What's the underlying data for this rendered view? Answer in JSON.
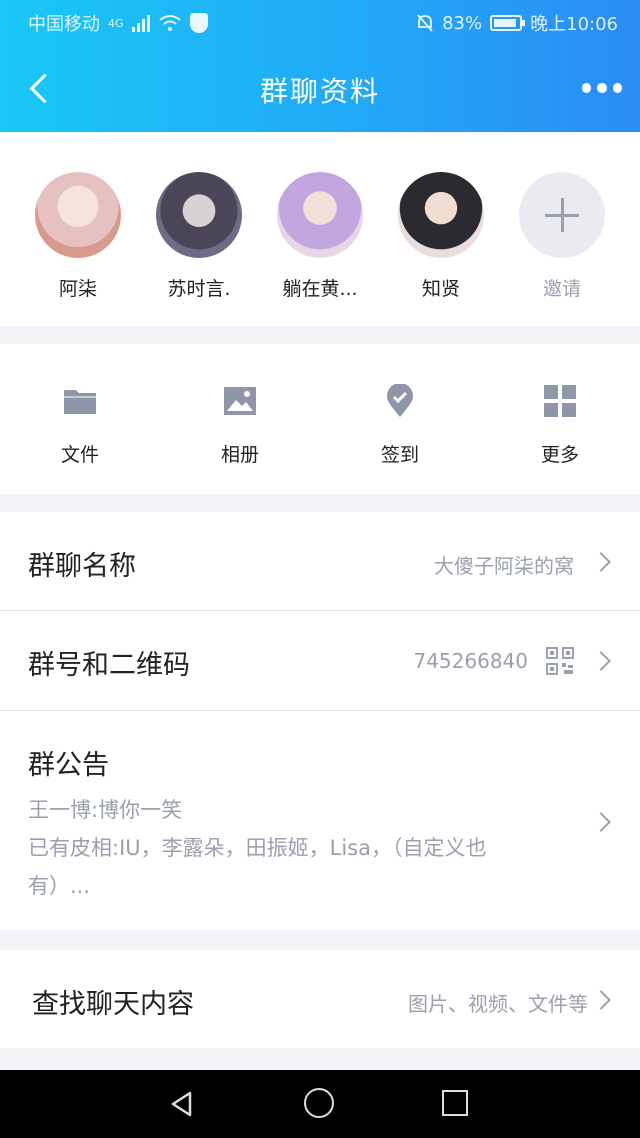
{
  "status_bar": {
    "carrier": "中国移动",
    "network": "4G",
    "battery": "83%",
    "time": "晚上10:06"
  },
  "nav": {
    "title": "群聊资料"
  },
  "members": [
    {
      "name": "阿柒",
      "avatar_color": "#e8c9c8"
    },
    {
      "name": "苏时言.",
      "avatar_color": "#5a5a6e"
    },
    {
      "name": "躺在黄...",
      "avatar_color": "#b79bd9"
    },
    {
      "name": "知贤",
      "avatar_color": "#3c3c46"
    }
  ],
  "invite": {
    "label": "邀请"
  },
  "features": [
    {
      "label": "文件",
      "icon": "folder-icon"
    },
    {
      "label": "相册",
      "icon": "image-icon"
    },
    {
      "label": "签到",
      "icon": "checkin-icon"
    },
    {
      "label": "更多",
      "icon": "grid-icon"
    }
  ],
  "group_name": {
    "label": "群聊名称",
    "value": "大傻子阿柒的窝"
  },
  "group_id": {
    "label": "群号和二维码",
    "value": "745266840"
  },
  "notice": {
    "label": "群公告",
    "line1": "王一博:博你一笑",
    "line2": "已有皮相:IU，李露朵，田振姬，Lisa，（自定义也",
    "line3": "有）..."
  },
  "search_chat": {
    "label": "查找聊天内容",
    "value": "图片、视频、文件等"
  },
  "colors": {
    "accent": "#21a9f7",
    "icon_gray": "#8f96a8",
    "muted": "#9aa0ad"
  }
}
